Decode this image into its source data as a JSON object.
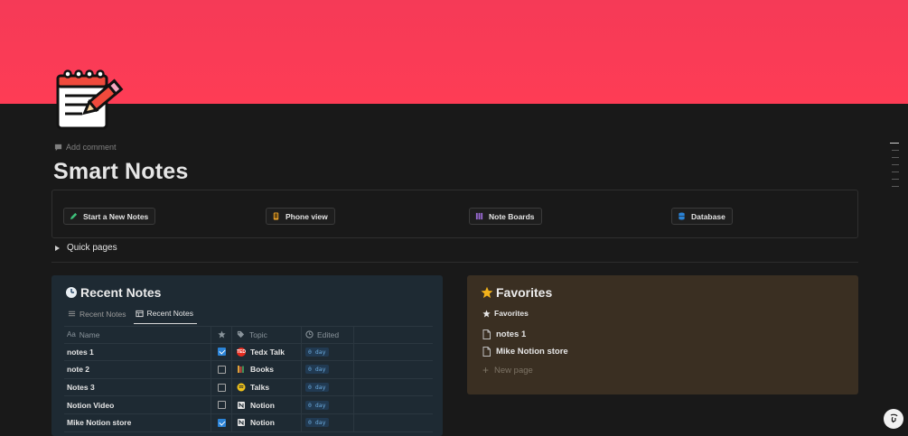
{
  "page": {
    "title": "Smart Notes",
    "add_comment": "Add comment",
    "quick_pages": "Quick pages",
    "cover_color": "#fe3c55"
  },
  "links": [
    {
      "label": "Start a New Notes",
      "icon": "pencil-icon",
      "color": "#3ec07a"
    },
    {
      "label": "Phone view",
      "icon": "phone-icon",
      "color": "#f0a52b"
    },
    {
      "label": "Note Boards",
      "icon": "boards-icon",
      "color": "#9b6bd6"
    },
    {
      "label": "Database",
      "icon": "database-icon",
      "color": "#2b83d6"
    }
  ],
  "recent": {
    "title": "Recent Notes",
    "tabs": [
      {
        "label": "Recent Notes",
        "icon": "list-icon"
      },
      {
        "label": "Recent Notes",
        "icon": "table-icon"
      }
    ],
    "columns": {
      "name": "Name",
      "topic": "Topic",
      "edited": "Edited"
    },
    "rows": [
      {
        "name": "notes 1",
        "starred": true,
        "topic": "Tedx Talk",
        "topic_icon": "tedx-icon",
        "edited": "0 day"
      },
      {
        "name": "note 2",
        "starred": false,
        "topic": "Books",
        "topic_icon": "books-icon",
        "edited": "0 day"
      },
      {
        "name": "Notes 3",
        "starred": false,
        "topic": "Talks",
        "topic_icon": "talks-icon",
        "edited": "0 day"
      },
      {
        "name": "Notion Video",
        "starred": false,
        "topic": "Notion",
        "topic_icon": "notion-icon",
        "edited": "0 day"
      },
      {
        "name": "Mike Notion store",
        "starred": true,
        "topic": "Notion",
        "topic_icon": "notion-icon",
        "edited": "0 day"
      }
    ]
  },
  "favorites": {
    "title": "Favorites",
    "subtitle": "Favorites",
    "items": [
      "notes 1",
      "Mike Notion store"
    ],
    "new_page": "New page"
  }
}
